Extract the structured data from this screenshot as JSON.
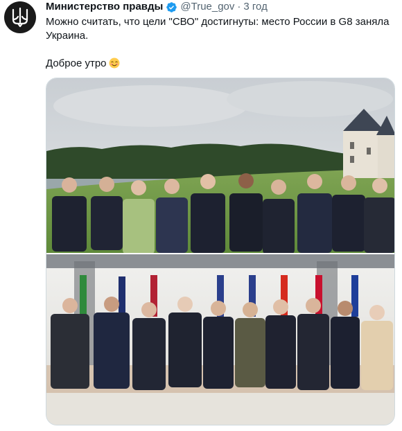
{
  "tweet": {
    "author_name": "Министерство правды",
    "handle": "@True_gov",
    "separator": "·",
    "time": "3 год",
    "text_line1": "Можно считать, что цели \"СВО\" достигнуты: место России в G8 заняла Украина.",
    "text_line2": "Доброе утро"
  },
  "colors": {
    "verified": "#1d9bf0",
    "secondary_text": "#536471",
    "avatar_bg": "#1a1a1a",
    "media_border": "#cfd9de"
  },
  "icons": {
    "avatar": "trident-icon",
    "verified": "verified-badge-icon",
    "emoji": "smiling-face-emoji"
  }
}
